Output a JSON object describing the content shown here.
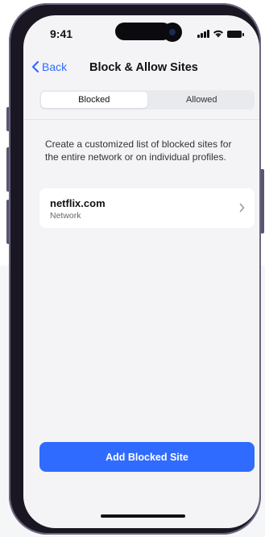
{
  "status_bar": {
    "time": "9:41",
    "icons": [
      "signal-icon",
      "wifi-icon",
      "battery-icon"
    ]
  },
  "nav": {
    "back_label": "Back",
    "title": "Block & Allow Sites"
  },
  "segments": [
    {
      "label": "Blocked",
      "active": true
    },
    {
      "label": "Allowed",
      "active": false
    }
  ],
  "description": "Create a customized list of blocked sites for the entire network or on individual profiles.",
  "sites": [
    {
      "name": "netflix.com",
      "scope": "Network"
    }
  ],
  "primary_action": {
    "label": "Add Blocked Site"
  },
  "colors": {
    "accent": "#2f6bff",
    "frame": "#1a1722",
    "screen_bg": "#f4f4f6"
  }
}
